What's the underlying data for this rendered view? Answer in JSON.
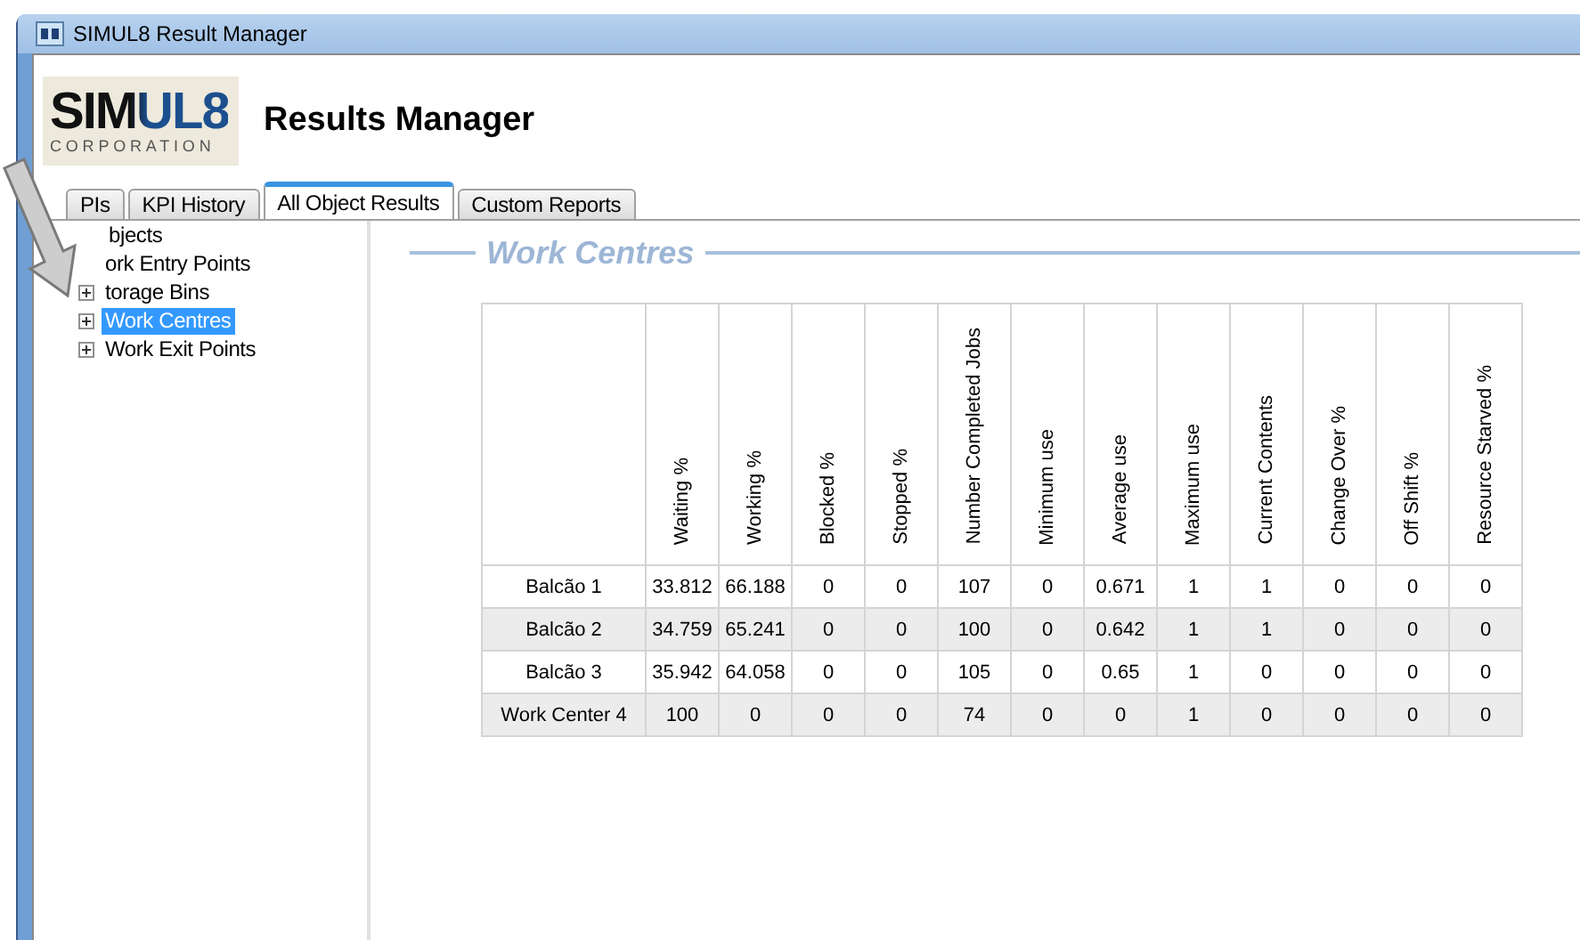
{
  "window": {
    "title": "SIMUL8 Result Manager"
  },
  "logo": {
    "name": "SIMUL8",
    "subtitle": "CORPORATION"
  },
  "header": {
    "title": "Results Manager"
  },
  "tabs": [
    {
      "label": "PIs",
      "selected": false
    },
    {
      "label": "KPI History",
      "selected": false
    },
    {
      "label": "All Object Results",
      "selected": true
    },
    {
      "label": "Custom Reports",
      "selected": false
    }
  ],
  "tree": {
    "label": "bjects",
    "selected": false,
    "children": [
      {
        "label": "ork Entry Points",
        "selected": false
      },
      {
        "label": "torage Bins",
        "expanded": false,
        "selected": false
      },
      {
        "label": "Work Centres",
        "expanded": false,
        "selected": true
      },
      {
        "label": "Work Exit Points",
        "expanded": false,
        "selected": false
      }
    ]
  },
  "section": {
    "title": "Work Centres"
  },
  "table": {
    "columns": [
      "Waiting %",
      "Working %",
      "Blocked %",
      "Stopped %",
      "Number Completed Jobs",
      "Minimum use",
      "Average use",
      "Maximum use",
      "Current Contents",
      "Change Over %",
      "Off Shift %",
      "Resource Starved %"
    ],
    "rows": [
      {
        "name": "Balcão 1",
        "cells": [
          "33.812",
          "66.188",
          "0",
          "0",
          "107",
          "0",
          "0.671",
          "1",
          "1",
          "0",
          "0",
          "0"
        ]
      },
      {
        "name": "Balcão 2",
        "cells": [
          "34.759",
          "65.241",
          "0",
          "0",
          "100",
          "0",
          "0.642",
          "1",
          "1",
          "0",
          "0",
          "0"
        ]
      },
      {
        "name": "Balcão 3",
        "cells": [
          "35.942",
          "64.058",
          "0",
          "0",
          "105",
          "0",
          "0.65",
          "1",
          "0",
          "0",
          "0",
          "0"
        ]
      },
      {
        "name": "Work Center 4",
        "cells": [
          "100",
          "0",
          "0",
          "0",
          "74",
          "0",
          "0",
          "1",
          "0",
          "0",
          "0",
          "0"
        ]
      }
    ]
  }
}
